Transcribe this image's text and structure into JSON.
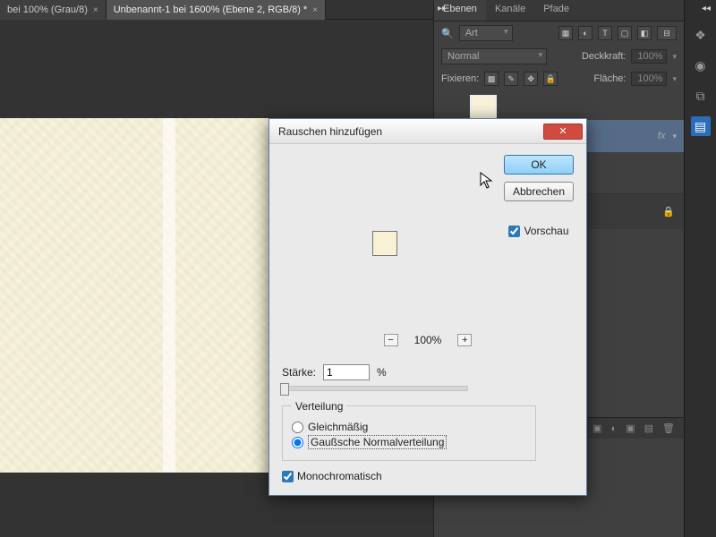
{
  "tabs": [
    {
      "label": "bei 100% (Grau/8)",
      "active": false
    },
    {
      "label": "Unbenannt-1 bei 1600% (Ebene 2, RGB/8) *",
      "active": true
    }
  ],
  "layers_panel": {
    "tabs": {
      "ebenen": "Ebenen",
      "kanale": "Kanäle",
      "pfade": "Pfade"
    },
    "filter_label": "Art",
    "blend_mode": "Normal",
    "opacity_label": "Deckkraft:",
    "opacity_value": "100%",
    "lock_label": "Fixieren:",
    "fill_label": "Fläche:",
    "fill_value": "100%",
    "fx_label": "fx"
  },
  "iconbar": {
    "layers": "layers",
    "color": "color",
    "swatches": "swatches",
    "history": "history"
  },
  "dialog": {
    "title": "Rauschen hinzufügen",
    "ok": "OK",
    "cancel": "Abbrechen",
    "preview": "Vorschau",
    "zoom_value": "100%",
    "strength_label": "Stärke:",
    "strength_value": "1",
    "strength_unit": "%",
    "distribution_legend": "Verteilung",
    "dist_uniform": "Gleichmäßig",
    "dist_gaussian": "Gaußsche Normalverteilung",
    "monochrome": "Monochromatisch"
  }
}
